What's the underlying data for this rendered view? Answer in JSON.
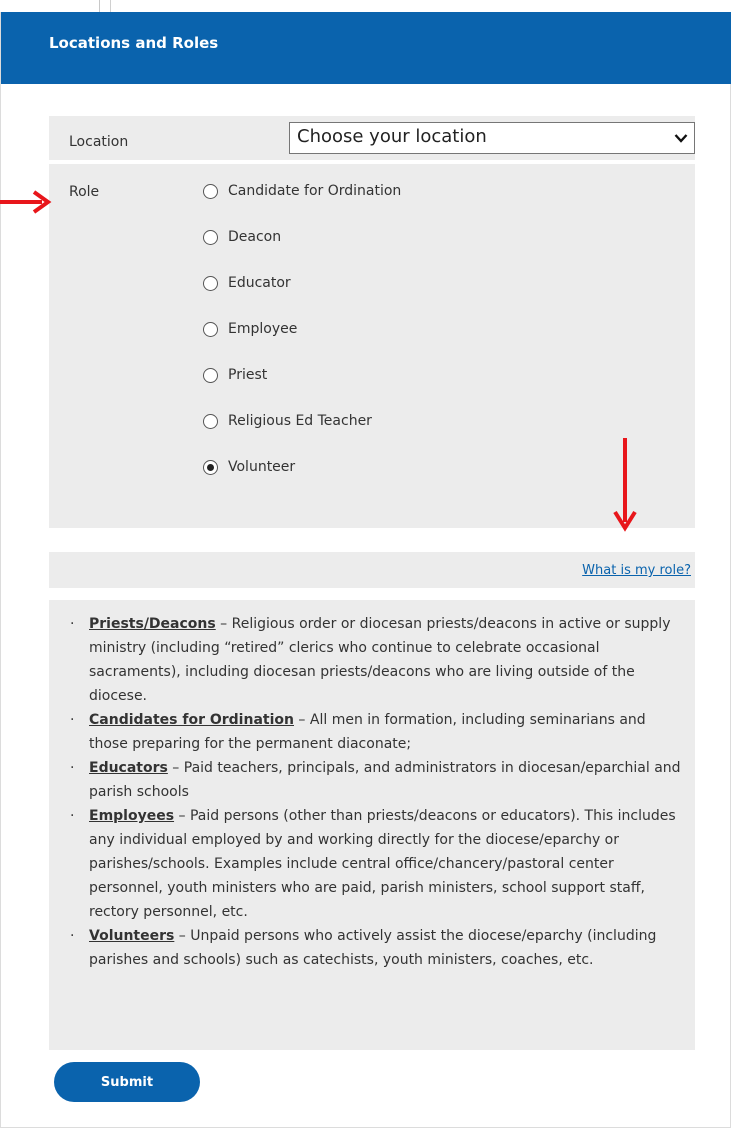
{
  "header": {
    "title": "Locations and Roles"
  },
  "location": {
    "label": "Location",
    "selected": "Choose your location"
  },
  "role": {
    "label": "Role",
    "options": [
      {
        "label": "Candidate for Ordination",
        "checked": false
      },
      {
        "label": "Deacon",
        "checked": false
      },
      {
        "label": "Educator",
        "checked": false
      },
      {
        "label": "Employee",
        "checked": false
      },
      {
        "label": "Priest",
        "checked": false
      },
      {
        "label": "Religious Ed Teacher",
        "checked": false
      },
      {
        "label": "Volunteer",
        "checked": true
      }
    ]
  },
  "help_link": "What is my role?",
  "descriptions": [
    {
      "term": "Priests/Deacons",
      "text": " – Religious order or diocesan priests/deacons in active or supply ministry (including “retired” clerics who continue to celebrate occasional sacraments), including diocesan priests/deacons who are living outside of the diocese."
    },
    {
      "term": "Candidates for Ordination",
      "text": " – All men in formation, including seminarians and those preparing for the permanent diaconate;"
    },
    {
      "term": "Educators",
      "text": " – Paid teachers, principals, and administrators in diocesan/eparchial and parish schools"
    },
    {
      "term": "Employees",
      "text": " – Paid persons (other than priests/deacons or educators). This includes any individual employed by and working directly for the diocese/eparchy or parishes/schools. Examples include central office/chancery/pastoral center personnel, youth ministers who are paid, parish ministers, school support staff, rectory personnel, etc."
    },
    {
      "term": "Volunteers",
      "text": " – Unpaid persons who actively assist the diocese/eparchy (including parishes and schools) such as catechists, youth ministers, coaches, etc."
    }
  ],
  "submit_label": "Submit",
  "colors": {
    "brand": "#0a63ad",
    "panel": "#ececec",
    "annotation_arrow": "#e8161b"
  }
}
